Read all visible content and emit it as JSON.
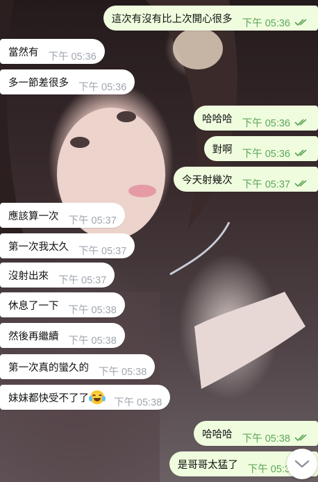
{
  "chat": {
    "messages": [
      {
        "direction": "out",
        "text": "這次有沒有比上次開心很多",
        "time": "下午 05:36",
        "read": true
      },
      {
        "direction": "in",
        "text": "當然有",
        "time": "下午 05:36"
      },
      {
        "direction": "in",
        "text": "多一節差很多",
        "time": "下午 05:36"
      },
      {
        "direction": "out",
        "text": "哈哈哈",
        "time": "下午 05:36",
        "read": true
      },
      {
        "direction": "out",
        "text": "對啊",
        "time": "下午 05:36",
        "read": true
      },
      {
        "direction": "out",
        "text": "今天射幾次",
        "time": "下午 05:37",
        "read": true
      },
      {
        "direction": "in",
        "text": "應該算一次",
        "time": "下午 05:37"
      },
      {
        "direction": "in",
        "text": "第一次我太久",
        "time": "下午 05:37"
      },
      {
        "direction": "in",
        "text": "沒射出來",
        "time": "下午 05:37"
      },
      {
        "direction": "in",
        "text": "休息了一下",
        "time": "下午 05:38"
      },
      {
        "direction": "in",
        "text": "然後再繼續",
        "time": "下午 05:38"
      },
      {
        "direction": "in",
        "text": "第一次真的蠻久的",
        "time": "下午 05:38"
      },
      {
        "direction": "in",
        "text": "妹妹都快受不了了",
        "time": "下午 05:38",
        "emoji": "face-with-tears-of-joy"
      },
      {
        "direction": "out",
        "text": "哈哈哈",
        "time": "下午 05:38",
        "read": true
      },
      {
        "direction": "out",
        "text": "是哥哥太猛了",
        "time": "下午 05:3",
        "read": true
      }
    ]
  },
  "scroll_down_icon": "chevron-down-icon",
  "colors": {
    "incoming_bubble": "#ffffff",
    "outgoing_bubble": "#effdde",
    "outgoing_time": "#5fa65a",
    "incoming_time": "#a0a7af"
  }
}
